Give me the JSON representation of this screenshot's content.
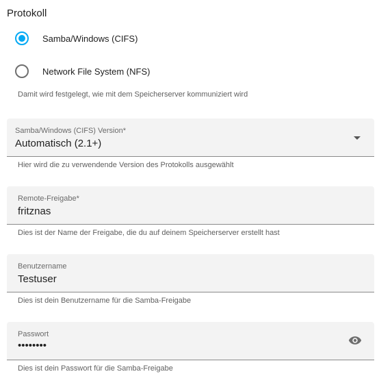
{
  "protocol": {
    "title": "Protokoll",
    "options": [
      {
        "label": "Samba/Windows (CIFS)",
        "checked": true
      },
      {
        "label": "Network File System (NFS)",
        "checked": false
      }
    ],
    "helper": "Damit wird festgelegt, wie mit dem Speicherserver kommuniziert wird"
  },
  "version": {
    "label": "Samba/Windows (CIFS) Version*",
    "value": "Automatisch (2.1+)",
    "helper": "Hier wird die zu verwendende Version des Protokolls ausgewählt"
  },
  "share": {
    "label": "Remote-Freigabe*",
    "value": "fritznas",
    "helper": "Dies ist der Name der Freigabe, die du auf deinem Speicherserver erstellt hast"
  },
  "username": {
    "label": "Benutzername",
    "value": "Testuser",
    "helper": "Dies ist dein Benutzername für die Samba-Freigabe"
  },
  "password": {
    "label": "Passwort",
    "value": "••••••••",
    "helper": "Dies ist dein Passwort für die Samba-Freigabe"
  },
  "colors": {
    "accent": "#03a9f4",
    "field_bg": "#f3f3f3"
  },
  "icons": {
    "visibility": "eye-icon",
    "dropdown": "dropdown-arrow-icon"
  }
}
